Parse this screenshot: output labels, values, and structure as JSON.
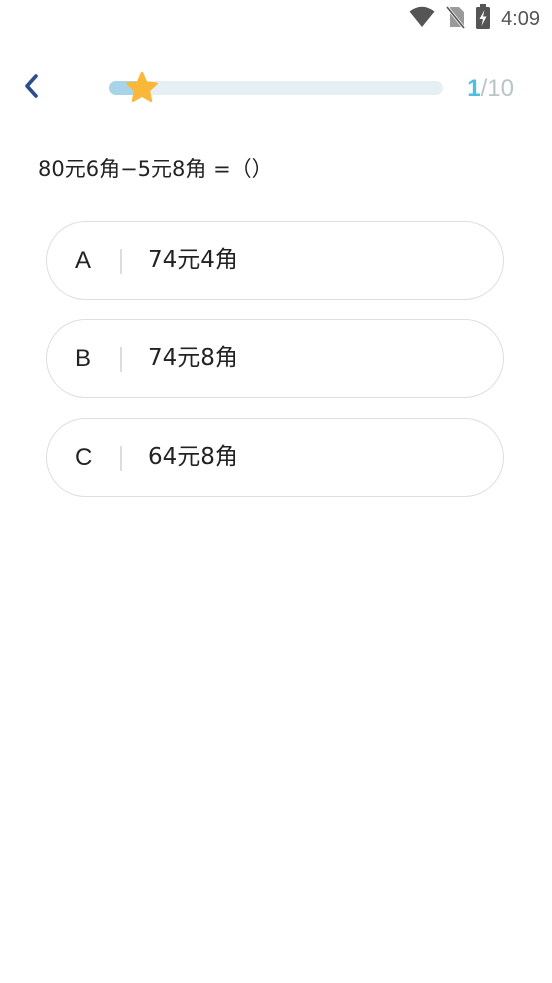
{
  "status_bar": {
    "time": "4:09",
    "icons": [
      "wifi-icon",
      "no-sim-icon",
      "battery-charging-icon"
    ]
  },
  "header": {
    "back_icon": "chevron-left-icon",
    "progress": {
      "current": "1",
      "separator": "/",
      "total": "10",
      "fraction": 0.1
    },
    "star_icon": "star-icon"
  },
  "question": {
    "text": "80元6角−5元8角 =（）"
  },
  "options": [
    {
      "letter": "A",
      "text": "74元4角"
    },
    {
      "letter": "B",
      "text": "74元8角"
    },
    {
      "letter": "C",
      "text": "64元8角"
    }
  ],
  "colors": {
    "accent": "#4cc0e0",
    "progress_fill": "#a8d4ea",
    "progress_track": "#e6f0f4",
    "star": "#f9b83a",
    "back_arrow": "#2d4e8c",
    "counter_muted": "#b8c4c8"
  }
}
